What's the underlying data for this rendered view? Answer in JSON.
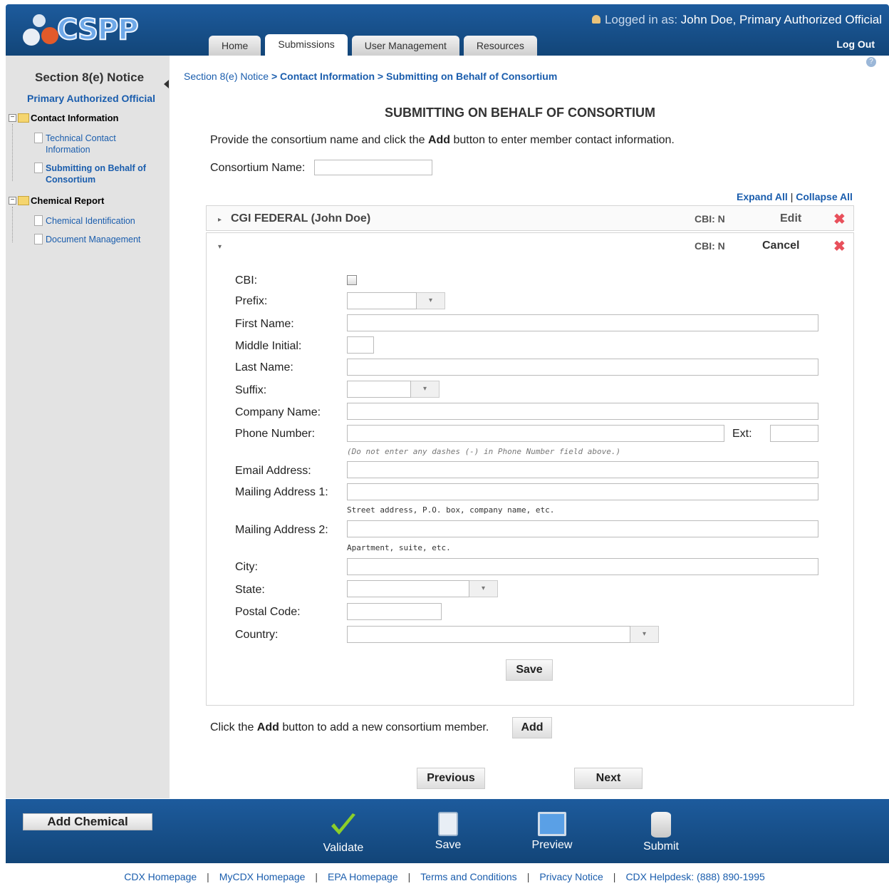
{
  "header": {
    "logo_text": "CSPP",
    "logged_in_prefix": "Logged in as:",
    "logged_in_user": "John Doe, Primary Authorized Official",
    "logout": "Log Out",
    "tabs": [
      {
        "label": "Home",
        "active": false
      },
      {
        "label": "Submissions",
        "active": true
      },
      {
        "label": "User Management",
        "active": false
      },
      {
        "label": "Resources",
        "active": false
      }
    ]
  },
  "sidebar": {
    "title": "Section 8(e) Notice",
    "role": "Primary Authorized Official",
    "groups": [
      {
        "label": "Contact Information",
        "items": [
          "Technical Contact Information",
          "Submitting on Behalf of Consortium"
        ]
      },
      {
        "label": "Chemical Report",
        "items": [
          "Chemical Identification",
          "Document Management"
        ]
      }
    ]
  },
  "breadcrumb": {
    "first": "Section 8(e) Notice",
    "second": "Contact Information",
    "third": "Submitting on Behalf of Consortium",
    "sep": ">"
  },
  "main": {
    "title": "SUBMITTING ON BEHALF OF CONSORTIUM",
    "intro_pre": "Provide the consortium name and click the ",
    "intro_bold": "Add",
    "intro_post": " button to enter member contact information.",
    "consortium_label": "Consortium Name:",
    "consortium_value": "",
    "expand_all": "Expand All",
    "collapse_all": "Collapse All",
    "members": [
      {
        "name": "CGI FEDERAL (John Doe)",
        "cbi": "CBI: N",
        "action": "Edit"
      },
      {
        "name": "",
        "cbi": "CBI: N",
        "action": "Cancel"
      }
    ],
    "form": {
      "cbi_label": "CBI:",
      "prefix_label": "Prefix:",
      "first_name_label": "First Name:",
      "middle_initial_label": "Middle Initial:",
      "last_name_label": "Last Name:",
      "suffix_label": "Suffix:",
      "company_label": "Company Name:",
      "phone_label": "Phone Number:",
      "ext_label": "Ext:",
      "phone_hint": "(Do not enter any dashes (-) in Phone Number field above.)",
      "email_label": "Email Address:",
      "mail1_label": "Mailing Address 1:",
      "mail1_hint": "Street address, P.O. box, company name, etc.",
      "mail2_label": "Mailing Address 2:",
      "mail2_hint": "Apartment, suite, etc.",
      "city_label": "City:",
      "state_label": "State:",
      "postal_label": "Postal Code:",
      "country_label": "Country:",
      "save": "Save"
    },
    "add_pre": "Click the ",
    "add_bold": "Add",
    "add_post": " button to add a new consortium member.",
    "add_button": "Add",
    "previous": "Previous",
    "next": "Next"
  },
  "footer": {
    "add_chemical": "Add Chemical",
    "validate": "Validate",
    "save": "Save",
    "preview": "Preview",
    "submit": "Submit",
    "links": [
      "CDX Homepage",
      "MyCDX Homepage",
      "EPA Homepage",
      "Terms and Conditions",
      "Privacy Notice",
      "CDX Helpdesk: (888) 890-1995"
    ],
    "link_sep": "|"
  },
  "colors": {
    "brand_blue": "#154e8a",
    "link": "#1a5dad",
    "delete": "#e8505b",
    "validate_check": "#8ccf2a"
  }
}
